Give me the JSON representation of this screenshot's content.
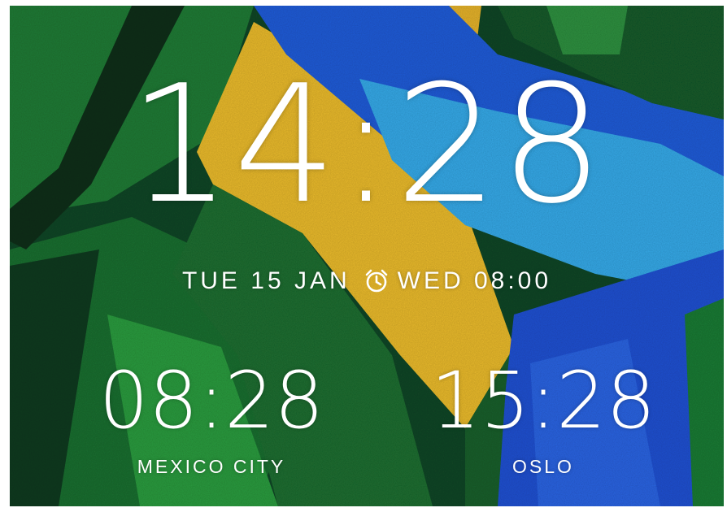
{
  "main_clock": {
    "time": "14:28"
  },
  "date_info": {
    "date": "TUE 15 JAN",
    "alarm_icon": "alarm-clock-icon",
    "next_alarm": "WED 08:00"
  },
  "world_clocks": [
    {
      "time": "08:28",
      "city": "MEXICO CITY"
    },
    {
      "time": "15:28",
      "city": "OSLO"
    }
  ],
  "colors": {
    "text": "#ffffff",
    "wallpaper_green_dark": "#123f22",
    "wallpaper_green": "#1f7a35",
    "wallpaper_yellow": "#e8b92c",
    "wallpaper_blue": "#1f5bd6",
    "wallpaper_light_blue": "#35a8e6"
  }
}
